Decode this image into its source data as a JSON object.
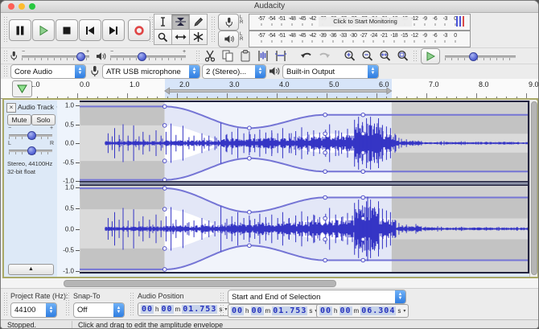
{
  "window": {
    "title": "Audacity"
  },
  "colors": {
    "wave": "#3535c5",
    "envelope": "#7575d5",
    "circle_stroke": "#5050c8",
    "sel_inside": "#ffffff",
    "sel_wedge": "#e3e7f7",
    "sel_outside": "#f1f4fb",
    "unsel_inside": "#dadada",
    "unsel_wedge": "#c3c3c3",
    "unsel_outside": "#cfcfcf",
    "ruler_selection": "#d7e5f9",
    "clip_edge": "#23233f",
    "traffic": [
      "#ff5f57",
      "#febc2e",
      "#28c840"
    ],
    "record_red": "#e04545",
    "play_green": "#8ed08e",
    "play_green_dark": "#3c8a3c"
  },
  "transport": {
    "buttons": [
      "pause",
      "play",
      "stop",
      "skip-to-start",
      "skip-to-end",
      "record"
    ]
  },
  "tools": {
    "buttons": [
      "selection-tool",
      "envelope-tool",
      "draw-tool",
      "zoom-tool",
      "timeshift-tool",
      "multi-tool"
    ],
    "selected": "envelope-tool"
  },
  "meters": {
    "lr_l": "L",
    "lr_r": "R",
    "monitor_label": "Click to Start Monitoring",
    "record_scale": [
      "-57",
      "-54",
      "-51",
      "-48",
      "-45",
      "-42",
      "-39",
      "-36",
      "-33",
      "-30",
      "-27",
      "-24",
      "-21",
      "-18",
      "-15",
      "-12",
      "-9",
      "-6",
      "-3",
      "0"
    ],
    "play_scale": [
      "-57",
      "-54",
      "-51",
      "-48",
      "-45",
      "-42",
      "-39",
      "-36",
      "-33",
      "-30",
      "-27",
      "-24",
      "-21",
      "-18",
      "-15",
      "-12",
      "-9",
      "-6",
      "-3",
      "0"
    ]
  },
  "mixer": {
    "minus": "−",
    "plus": "+"
  },
  "device": {
    "host": "Core Audio",
    "input": "ATR USB microphone",
    "channels": "2 (Stereo)...",
    "output": "Built-in Output"
  },
  "timeline": {
    "labels": [
      "1.0",
      "0.0",
      "1.0",
      "2.0",
      "3.0",
      "4.0",
      "5.0",
      "6.0",
      "7.0",
      "8.0",
      "9.0"
    ],
    "times": [
      -1,
      0,
      1,
      2,
      3,
      4,
      5,
      6,
      7,
      8,
      9
    ]
  },
  "selection": {
    "start_s": 1.753,
    "end_s": 6.304
  },
  "track": {
    "close_glyph": "×",
    "name": "Audio Track",
    "dropdown_glyph": "▼",
    "mute": "Mute",
    "solo": "Solo",
    "gain_minus": "−",
    "gain_plus": "+",
    "pan_l": "L",
    "pan_r": "R",
    "info1": "Stereo, 44100Hz",
    "info2": "32-bit float",
    "collapse_glyph": "▲",
    "amp_scale": [
      "1.0",
      "0.5",
      "0.0",
      "-0.5",
      "-1.0"
    ]
  },
  "waveform": {
    "clip_start_s": 0.55,
    "clip_end_s": 9.05,
    "envelope_points": [
      [
        -0.2,
        0.97
      ],
      [
        1.753,
        0.97
      ],
      [
        3.45,
        0.4
      ],
      [
        4.97,
        0.75
      ],
      [
        9.3,
        0.75
      ]
    ],
    "control_points_s": [
      1.753,
      3.45,
      4.97,
      5.73
    ],
    "noise_segments": [
      [
        0.55,
        1.75,
        0.045
      ],
      [
        1.75,
        2.9,
        0.06
      ],
      [
        2.9,
        3.6,
        0.09
      ],
      [
        3.6,
        4.4,
        0.11
      ],
      [
        4.4,
        5.0,
        0.13
      ],
      [
        5.0,
        5.55,
        0.16
      ],
      [
        5.55,
        6.05,
        0.38
      ],
      [
        6.05,
        6.4,
        0.18
      ],
      [
        6.4,
        6.9,
        0.05
      ],
      [
        6.9,
        9.05,
        0.025
      ]
    ],
    "spikes": [
      [
        0.62,
        0.26
      ],
      [
        0.7,
        0.18
      ],
      [
        0.75,
        0.4
      ],
      [
        0.84,
        0.22
      ],
      [
        0.92,
        0.5
      ],
      [
        1.02,
        0.2
      ],
      [
        1.13,
        0.47
      ],
      [
        1.24,
        0.18
      ],
      [
        1.32,
        0.3
      ],
      [
        1.45,
        0.22
      ],
      [
        1.58,
        0.34
      ],
      [
        1.68,
        0.2
      ],
      [
        1.78,
        0.3
      ],
      [
        1.88,
        0.52
      ],
      [
        1.98,
        0.22
      ],
      [
        2.12,
        0.46
      ],
      [
        2.24,
        0.16
      ],
      [
        2.34,
        0.2
      ],
      [
        2.5,
        0.26
      ],
      [
        2.64,
        0.2
      ],
      [
        2.76,
        0.18
      ],
      [
        2.88,
        0.54
      ],
      [
        3.0,
        0.24
      ],
      [
        3.1,
        0.3
      ],
      [
        3.22,
        0.4
      ],
      [
        3.34,
        0.26
      ],
      [
        3.45,
        0.32
      ],
      [
        3.56,
        0.24
      ],
      [
        3.66,
        0.36
      ],
      [
        3.78,
        0.28
      ],
      [
        3.9,
        0.34
      ],
      [
        4.02,
        0.26
      ],
      [
        4.12,
        0.4
      ],
      [
        4.25,
        0.26
      ],
      [
        4.38,
        0.32
      ],
      [
        4.5,
        0.42
      ],
      [
        4.62,
        0.3
      ],
      [
        4.74,
        0.34
      ],
      [
        4.86,
        0.28
      ],
      [
        4.98,
        0.36
      ],
      [
        5.06,
        0.5
      ],
      [
        5.18,
        0.34
      ],
      [
        5.3,
        0.28
      ],
      [
        5.42,
        0.38
      ],
      [
        5.56,
        0.62
      ],
      [
        5.64,
        0.7
      ],
      [
        5.72,
        0.56
      ],
      [
        5.8,
        0.66
      ],
      [
        5.88,
        0.7
      ],
      [
        5.96,
        0.52
      ],
      [
        6.04,
        0.66
      ],
      [
        6.12,
        0.48
      ],
      [
        6.2,
        0.44
      ],
      [
        6.28,
        0.4
      ],
      [
        6.45,
        0.14
      ],
      [
        6.6,
        0.1
      ],
      [
        6.9,
        0.06
      ],
      [
        7.3,
        0.05
      ],
      [
        7.7,
        0.05
      ],
      [
        8.2,
        0.04
      ],
      [
        8.7,
        0.03
      ]
    ]
  },
  "selbar": {
    "rate_label": "Project Rate (Hz):",
    "rate_value": "44100",
    "snap_label": "Snap-To",
    "snap_value": "Off",
    "pos_label": "Audio Position",
    "mode_value": "Start and End of Selection",
    "unit_h": "h",
    "unit_m": "m",
    "unit_s": "s",
    "arrow": "▾",
    "audio_position": {
      "h": "00",
      "m": "00",
      "s": "01.753"
    },
    "sel_start": {
      "h": "00",
      "m": "00",
      "s": "01.753"
    },
    "sel_end": {
      "h": "00",
      "m": "00",
      "s": "06.304"
    }
  },
  "status": {
    "state": "Stopped.",
    "hint": "Click and drag to edit the amplitude envelope"
  }
}
